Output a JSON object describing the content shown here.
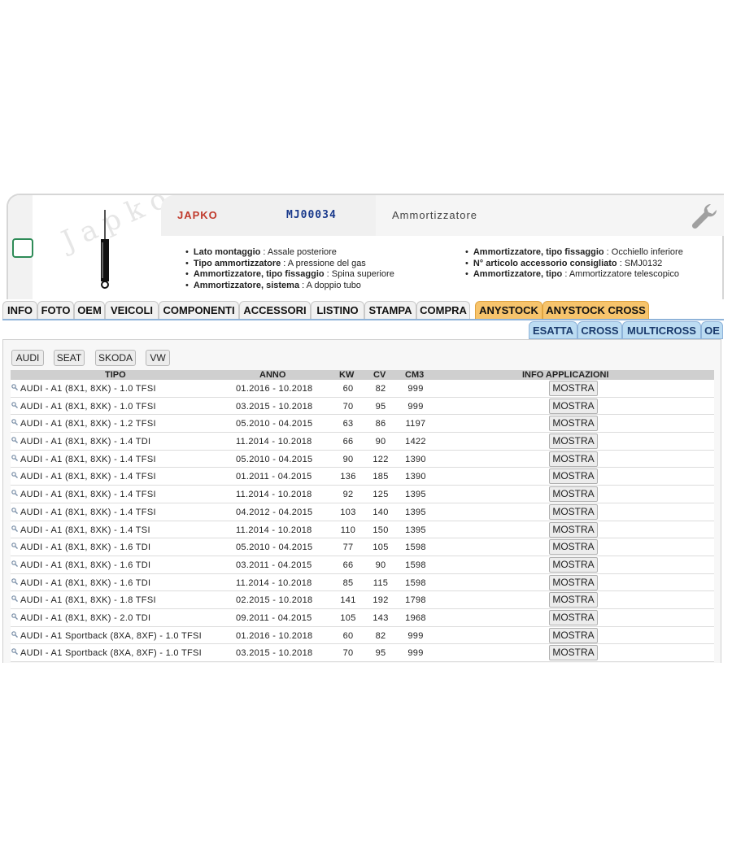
{
  "header": {
    "brand": "JAPKO",
    "code": "MJ00034",
    "description": "Ammortizzatore",
    "watermark": "Japko"
  },
  "specs_left": [
    {
      "label": "Lato montaggio",
      "value": "Assale posteriore"
    },
    {
      "label": "Tipo ammortizzatore",
      "value": "A pressione del gas"
    },
    {
      "label": "Ammortizzatore, tipo fissaggio",
      "value": "Spina superiore"
    },
    {
      "label": "Ammortizzatore, sistema",
      "value": "A doppio tubo"
    }
  ],
  "specs_right": [
    {
      "label": "Ammortizzatore, tipo fissaggio",
      "value": "Occhiello inferiore"
    },
    {
      "label": "N° articolo accessorio consigliato",
      "value": "SMJ0132"
    },
    {
      "label": "Ammortizzatore, tipo",
      "value": "Ammortizzatore telescopico"
    }
  ],
  "tabs": [
    "INFO",
    "FOTO",
    "OEM",
    "VEICOLI",
    "COMPONENTI",
    "ACCESSORI",
    "LISTINO",
    "STAMPA",
    "COMPRA",
    "ANYSTOCK",
    "ANYSTOCK CROSS"
  ],
  "subtabs": [
    "ESATTA",
    "CROSS",
    "MULTICROSS",
    "OE"
  ],
  "brand_filters": [
    "AUDI",
    "SEAT",
    "SKODA",
    "VW"
  ],
  "table": {
    "headers": {
      "tipo": "TIPO",
      "anno": "ANNO",
      "kw": "KW",
      "cv": "CV",
      "cm3": "CM3",
      "info": "INFO APPLICAZIONI"
    },
    "button_label": "MOSTRA",
    "rows": [
      {
        "tipo": "AUDI - A1 (8X1, 8XK) - 1.0 TFSI",
        "anno": "01.2016 - 10.2018",
        "kw": "60",
        "cv": "82",
        "cm3": "999"
      },
      {
        "tipo": "AUDI - A1 (8X1, 8XK) - 1.0 TFSI",
        "anno": "03.2015 - 10.2018",
        "kw": "70",
        "cv": "95",
        "cm3": "999"
      },
      {
        "tipo": "AUDI - A1 (8X1, 8XK) - 1.2 TFSI",
        "anno": "05.2010 - 04.2015",
        "kw": "63",
        "cv": "86",
        "cm3": "1197"
      },
      {
        "tipo": "AUDI - A1 (8X1, 8XK) - 1.4 TDI",
        "anno": "11.2014 - 10.2018",
        "kw": "66",
        "cv": "90",
        "cm3": "1422"
      },
      {
        "tipo": "AUDI - A1 (8X1, 8XK) - 1.4 TFSI",
        "anno": "05.2010 - 04.2015",
        "kw": "90",
        "cv": "122",
        "cm3": "1390"
      },
      {
        "tipo": "AUDI - A1 (8X1, 8XK) - 1.4 TFSI",
        "anno": "01.2011 - 04.2015",
        "kw": "136",
        "cv": "185",
        "cm3": "1390"
      },
      {
        "tipo": "AUDI - A1 (8X1, 8XK) - 1.4 TFSI",
        "anno": "11.2014 - 10.2018",
        "kw": "92",
        "cv": "125",
        "cm3": "1395"
      },
      {
        "tipo": "AUDI - A1 (8X1, 8XK) - 1.4 TFSI",
        "anno": "04.2012 - 04.2015",
        "kw": "103",
        "cv": "140",
        "cm3": "1395"
      },
      {
        "tipo": "AUDI - A1 (8X1, 8XK) - 1.4 TSI",
        "anno": "11.2014 - 10.2018",
        "kw": "110",
        "cv": "150",
        "cm3": "1395"
      },
      {
        "tipo": "AUDI - A1 (8X1, 8XK) - 1.6 TDI",
        "anno": "05.2010 - 04.2015",
        "kw": "77",
        "cv": "105",
        "cm3": "1598"
      },
      {
        "tipo": "AUDI - A1 (8X1, 8XK) - 1.6 TDI",
        "anno": "03.2011 - 04.2015",
        "kw": "66",
        "cv": "90",
        "cm3": "1598"
      },
      {
        "tipo": "AUDI - A1 (8X1, 8XK) - 1.6 TDI",
        "anno": "11.2014 - 10.2018",
        "kw": "85",
        "cv": "115",
        "cm3": "1598"
      },
      {
        "tipo": "AUDI - A1 (8X1, 8XK) - 1.8 TFSI",
        "anno": "02.2015 - 10.2018",
        "kw": "141",
        "cv": "192",
        "cm3": "1798"
      },
      {
        "tipo": "AUDI - A1 (8X1, 8XK) - 2.0 TDI",
        "anno": "09.2011 - 04.2015",
        "kw": "105",
        "cv": "143",
        "cm3": "1968"
      },
      {
        "tipo": "AUDI - A1 Sportback (8XA, 8XF) - 1.0 TFSI",
        "anno": "01.2016 - 10.2018",
        "kw": "60",
        "cv": "82",
        "cm3": "999"
      },
      {
        "tipo": "AUDI - A1 Sportback (8XA, 8XF) - 1.0 TFSI",
        "anno": "03.2015 - 10.2018",
        "kw": "70",
        "cv": "95",
        "cm3": "999"
      }
    ]
  },
  "colors": {
    "brand_red": "#c0392b",
    "code_blue": "#1a3a8c",
    "tab_orange": "#f7c46c",
    "subtab_blue": "#bcdcf2"
  },
  "icons": {
    "wrench": "wrench-icon",
    "lens": "magnifier-icon",
    "product": "shock-absorber-icon"
  }
}
